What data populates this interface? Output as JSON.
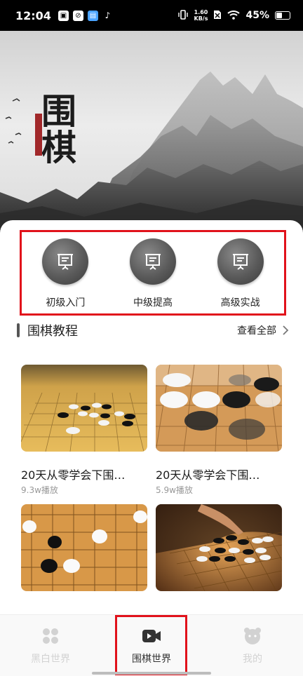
{
  "status_bar": {
    "time": "12:04",
    "net_speed_value": "1.60",
    "net_speed_unit": "KB/s",
    "battery": "45%",
    "battery_level": 0.45
  },
  "hero": {
    "title": "围棋"
  },
  "levels": [
    {
      "label": "初级入门",
      "icon": "presentation-icon"
    },
    {
      "label": "中级提高",
      "icon": "presentation-icon"
    },
    {
      "label": "高级实战",
      "icon": "presentation-icon"
    }
  ],
  "tutorials": {
    "title": "围棋教程",
    "see_all": "查看全部",
    "videos": [
      {
        "title": "20天从零学会下围…",
        "plays": "9.3w播放"
      },
      {
        "title": "20天从零学会下围…",
        "plays": "5.9w播放"
      },
      {
        "title": "",
        "plays": ""
      },
      {
        "title": "",
        "plays": ""
      }
    ]
  },
  "bottom_nav": [
    {
      "label": "黑白世界",
      "icon": "stones-grid-icon",
      "active": false
    },
    {
      "label": "围棋世界",
      "icon": "video-camera-icon",
      "active": true
    },
    {
      "label": "我的",
      "icon": "profile-face-icon",
      "active": false
    }
  ],
  "colors": {
    "highlight": "#e1121b",
    "board_wood": "#d9a653",
    "text_primary": "#222222",
    "text_muted": "#999999",
    "nav_inactive": "#d2d2d2"
  }
}
